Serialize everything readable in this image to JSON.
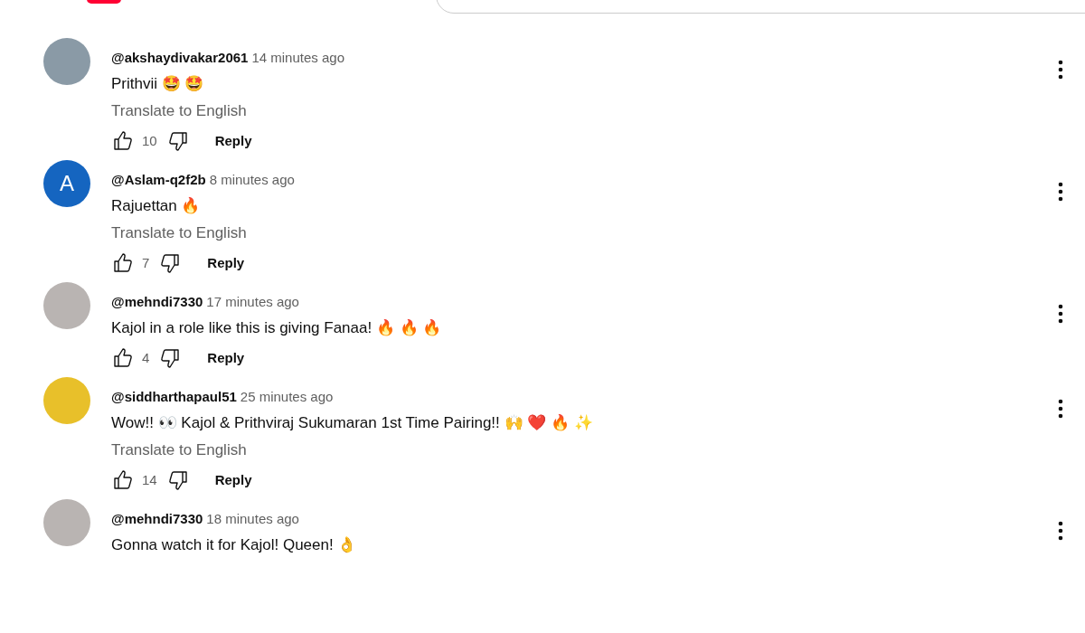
{
  "comments": [
    {
      "avatar": {
        "kind": "photo",
        "color": "#8a9aa6"
      },
      "username": "@akshaydivakar2061",
      "time": "14 minutes ago",
      "text": "Prithvii  🤩 🤩",
      "translate": "Translate to English",
      "likes": "10",
      "reply": "Reply"
    },
    {
      "avatar": {
        "kind": "letter",
        "letter": "A",
        "color": "#1565c0"
      },
      "username": "@Aslam-q2f2b",
      "time": "8 minutes ago",
      "text": "Rajuettan 🔥",
      "translate": "Translate to English",
      "likes": "7",
      "reply": "Reply"
    },
    {
      "avatar": {
        "kind": "photo",
        "color": "#b9b4b2"
      },
      "username": "@mehndi7330",
      "time": "17 minutes ago",
      "text": "Kajol in a role like this is giving Fanaa! 🔥 🔥 🔥",
      "likes": "4",
      "reply": "Reply"
    },
    {
      "avatar": {
        "kind": "photo",
        "color": "#e8c02a"
      },
      "username": "@siddharthapaul51",
      "time": "25 minutes ago",
      "text": "Wow!! 👀  Kajol & Prithviraj Sukumaran 1st Time Pairing!! 🙌 ❤️ 🔥 ✨",
      "translate": "Translate to English",
      "likes": "14",
      "reply": "Reply"
    },
    {
      "avatar": {
        "kind": "photo",
        "color": "#b9b4b2"
      },
      "username": "@mehndi7330",
      "time": "18 minutes ago",
      "text": "Gonna watch it for Kajol! Queen! 👌"
    }
  ]
}
